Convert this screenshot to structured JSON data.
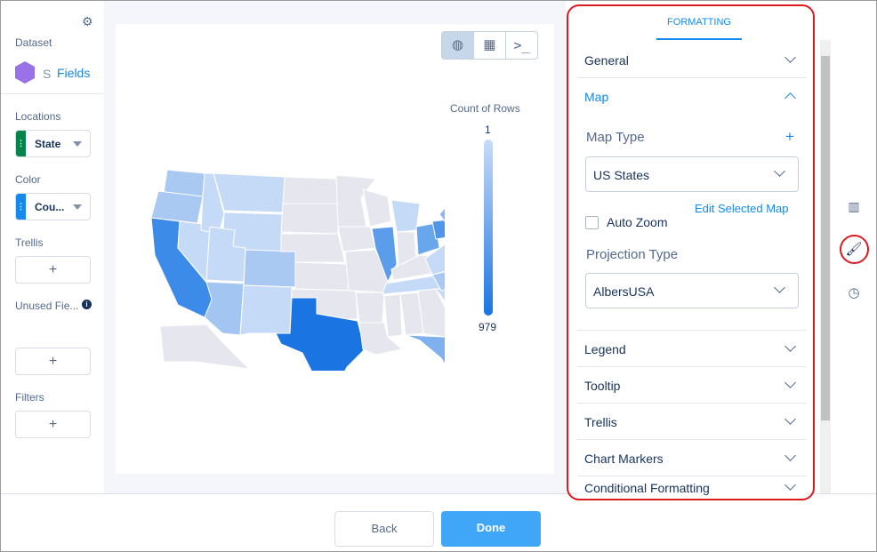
{
  "left": {
    "dataset_label": "Dataset",
    "dataset_name": "S",
    "fields_link": "Fields",
    "locations_label": "Locations",
    "location_field": "State",
    "color_label": "Color",
    "color_field": "Cou...",
    "trellis_label": "Trellis",
    "unused_label": "Unused Fie...",
    "filters_label": "Filters",
    "add": "+"
  },
  "toolbar": {
    "map_icon": "globe-icon",
    "table_icon": "table-icon",
    "query_icon": "terminal-icon"
  },
  "legend": {
    "title": "Count of Rows",
    "min": "1",
    "max": "979",
    "color_min": "#c8dcf7",
    "color_max": "#1a74e2"
  },
  "map": {
    "states": [
      {
        "id": "WA",
        "fill": "#a9c8f2"
      },
      {
        "id": "OR",
        "fill": "#a9c8f2"
      },
      {
        "id": "CA",
        "fill": "#3d8be8"
      },
      {
        "id": "NV",
        "fill": "#c4daf6"
      },
      {
        "id": "ID",
        "fill": "#c4daf6"
      },
      {
        "id": "MT",
        "fill": "#c4daf6"
      },
      {
        "id": "WY",
        "fill": "#c4daf6"
      },
      {
        "id": "UT",
        "fill": "#c4daf6"
      },
      {
        "id": "AZ",
        "fill": "#a2c5f2"
      },
      {
        "id": "CO",
        "fill": "#a9c8f2"
      },
      {
        "id": "NM",
        "fill": "#c4daf6"
      },
      {
        "id": "ND",
        "fill": "#e6e6ee"
      },
      {
        "id": "SD",
        "fill": "#e6e6ee"
      },
      {
        "id": "NE",
        "fill": "#e6e6ee"
      },
      {
        "id": "KS",
        "fill": "#e6e6ee"
      },
      {
        "id": "OK",
        "fill": "#e6e6ee"
      },
      {
        "id": "TX",
        "fill": "#1a74e2"
      },
      {
        "id": "MN",
        "fill": "#e6e6ee"
      },
      {
        "id": "IA",
        "fill": "#e6e6ee"
      },
      {
        "id": "MO",
        "fill": "#e6e6ee"
      },
      {
        "id": "AR",
        "fill": "#e6e6ee"
      },
      {
        "id": "LA",
        "fill": "#e6e6ee"
      },
      {
        "id": "WI",
        "fill": "#e6e6ee"
      },
      {
        "id": "IL",
        "fill": "#5b9deb"
      },
      {
        "id": "MI",
        "fill": "#c4daf6"
      },
      {
        "id": "IN",
        "fill": "#e6e6ee"
      },
      {
        "id": "OH",
        "fill": "#6aa6ec"
      },
      {
        "id": "KY",
        "fill": "#e6e6ee"
      },
      {
        "id": "TN",
        "fill": "#c4daf6"
      },
      {
        "id": "MS",
        "fill": "#e6e6ee"
      },
      {
        "id": "AL",
        "fill": "#e6e6ee"
      },
      {
        "id": "GA",
        "fill": "#e6e6ee"
      },
      {
        "id": "FL",
        "fill": "#7fb1ee"
      },
      {
        "id": "SC",
        "fill": "#c4daf6"
      },
      {
        "id": "NC",
        "fill": "#a9c8f2"
      },
      {
        "id": "VA",
        "fill": "#c4daf6"
      },
      {
        "id": "PA",
        "fill": "#4f95ea"
      },
      {
        "id": "NY",
        "fill": "#8ab8f0"
      },
      {
        "id": "NE_REG",
        "fill": "#e6e6ee"
      },
      {
        "id": "AK",
        "fill": "#e6e6ee"
      }
    ]
  },
  "formatting": {
    "tab": "FORMATTING",
    "general": "General",
    "map": "Map",
    "map_type_label": "Map Type",
    "map_type_value": "US States",
    "edit_map": "Edit Selected Map",
    "auto_zoom": "Auto Zoom",
    "auto_zoom_checked": false,
    "projection_label": "Projection Type",
    "projection_value": "AlbersUSA",
    "legend": "Legend",
    "tooltip": "Tooltip",
    "trellis": "Trellis",
    "chart_markers": "Chart Markers",
    "conditional": "Conditional Formatting",
    "add": "+"
  },
  "footer": {
    "back": "Back",
    "done": "Done"
  },
  "rail": {
    "chart_icon": "bar-chart-icon",
    "format_icon": "paint-roller-icon",
    "history_icon": "clock-icon"
  }
}
